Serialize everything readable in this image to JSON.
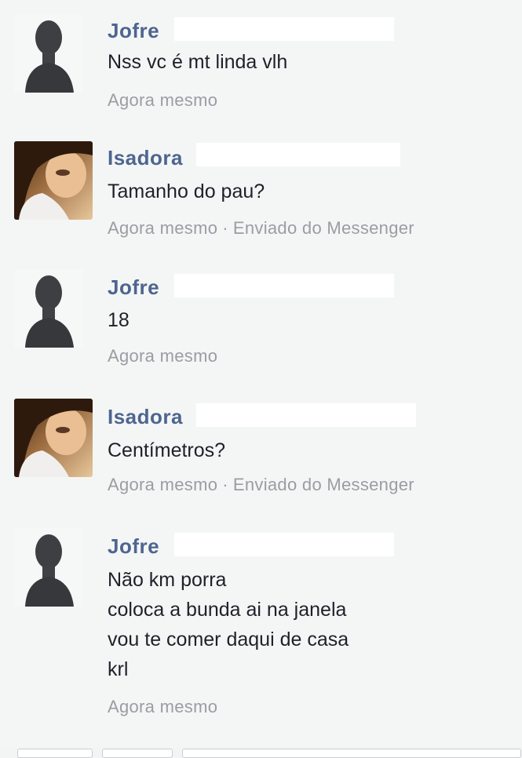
{
  "messages": [
    {
      "sender": "Jofre",
      "text": "Nss vc é mt linda vlh",
      "time": "Agora mesmo",
      "via": ""
    },
    {
      "sender": "Isadora",
      "text": "Tamanho do pau?",
      "time": "Agora mesmo",
      "via": "Enviado do Messenger"
    },
    {
      "sender": "Jofre",
      "text": "18",
      "time": "Agora mesmo",
      "via": ""
    },
    {
      "sender": "Isadora",
      "text": "Centímetros?",
      "time": "Agora mesmo",
      "via": "Enviado do Messenger"
    },
    {
      "sender": "Jofre",
      "text": "Não km porra\ncoloca a bunda ai na janela\nvou te comer daqui de casa\nkrl",
      "time": "Agora mesmo",
      "via": ""
    }
  ],
  "separator": "·",
  "colors": {
    "name": "#4e6590",
    "text": "#1d2129",
    "meta": "#9a9da3"
  },
  "icons": {
    "jofre_avatar": "person-silhouette-photo",
    "isadora_avatar": "profile-photo"
  }
}
